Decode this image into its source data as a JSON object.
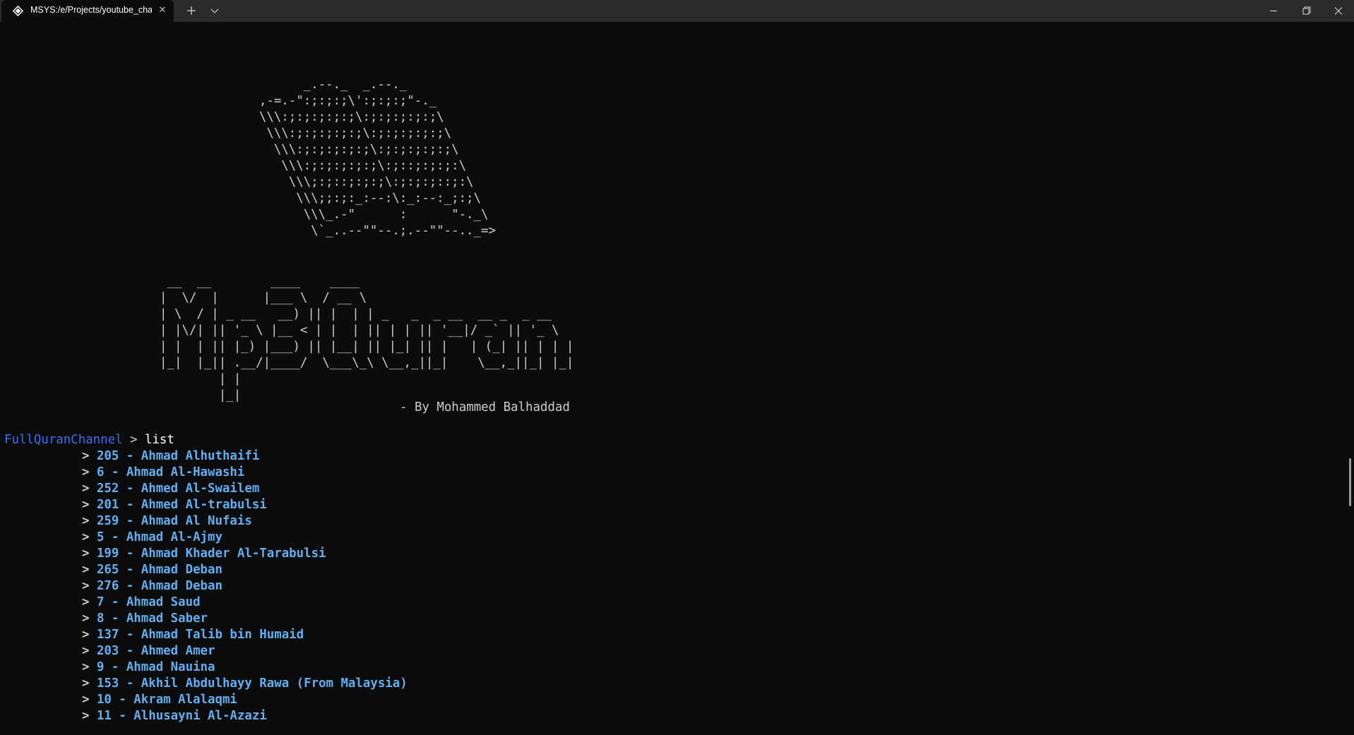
{
  "window": {
    "tab_title": "MSYS:/e/Projects/youtube_char",
    "tab_icon": "msys-diamond-icon",
    "close_tab_glyph": "✕",
    "new_tab_glyph": "+",
    "controls": [
      "minimize-icon",
      "maximize-icon",
      "close-icon"
    ]
  },
  "terminal": {
    "book_ascii": "          _.--._  _.--._\n    ,-=.-\":;:;:;\\':;:;:;\"-._\n    \\\\\\:;:;:;:;:;\\:;:;:;:;:;\\\n     \\\\\\:;:;:;:;:;\\:;:;:;:;:;\\\n      \\\\\\:;:;:;:;:;\\:;:;:;:;:;\\\n       \\\\\\:;:;:;:;:;\\:;::;:;:;:\\\n        \\\\\\;:;::;:;:;\\:;:;:;::;:\\\n         \\\\\\;;:;:_:--:\\:_:--:_;:;\\\n          \\\\\\_.-\"      :      \"-._\\\n           \\`_..--\"\"--.;.--\"\"--.._=>",
    "logo_ascii": " __  __        ____    ____\n|  \\/  |      |___ \\  / __ \\\n| \\  / | _ __   __) || |  | | _   _  _ __  __ _  _ __\n| |\\/| || '_ \\ |__ < | |  | || | | || '__|/ _` || '_ \\\n| |  | || |_) |___) || |__| || |_| || |   | (_| || | | |\n|_|  |_|| .__/|____/  \\___\\_\\ \\__,_||_|    \\__,_||_| |_|\n        | |\n        |_|",
    "byline": "- By Mohammed Balhaddad",
    "prompt": {
      "name": "FullQuranChannel",
      "symbol": " > ",
      "command": "list"
    },
    "list_arrow": "> ",
    "reciters": [
      "205 - Ahmad Alhuthaifi",
      "6 - Ahmad Al-Hawashi",
      "252 - Ahmed Al-Swailem",
      "201 - Ahmed Al-trabulsi",
      "259 - Ahmad Al Nufais",
      "5 - Ahmad Al-Ajmy",
      "199 - Ahmad Khader Al-Tarabulsi",
      "265 - Ahmad Deban",
      "276 - Ahmad Deban",
      "7 - Ahmad Saud",
      "8 - Ahmad Saber",
      "137 - Ahmad Talib bin Humaid",
      "203 - Ahmed Amer",
      "9 - Ahmad Nauina",
      "153 - Akhil Abdulhayy Rawa (From Malaysia)",
      "10 - Akram Alalaqmi",
      "11 - Alhusayni Al-Azazi"
    ],
    "colors": {
      "background": "#0c0c0c",
      "prompt_name": "#3a6ff0",
      "reciter_text": "#61aef0",
      "default_text": "#cccccc"
    }
  }
}
